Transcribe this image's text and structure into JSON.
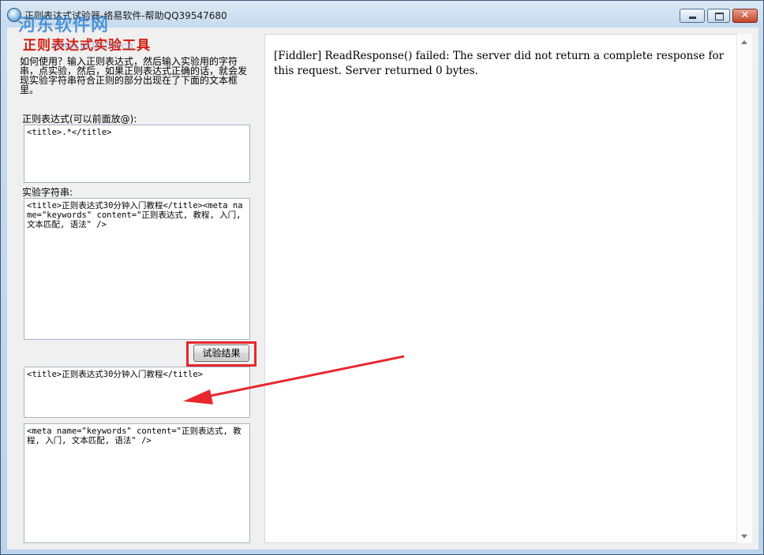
{
  "window": {
    "title": "正则表达式试验器-络易软件-帮助QQ39547680",
    "watermark": "河东软件网",
    "watermark_url": "www.pc0359.cn"
  },
  "app": {
    "heading": "正则表达式实验工具",
    "howto": "如何使用？输入正则表达式，然后输入实验用的字符串，点实验，然后，如果正则表达式正确的话，就会发现实验字符串符合正则的部分出现在了下面的文本框里。",
    "regex_label": "正则表达式(可以前面放@):",
    "regex_value": "<title>.*</title>",
    "test_string_label": "实验字符串:",
    "test_string_value": "<title>正则表达式30分钟入门教程</title><meta name=\"keywords\" content=\"正则表达式, 教程, 入门, 文本匹配, 语法\" />",
    "test_button": "试验结果",
    "result_1": "<title>正则表达式30分钟入门教程</title>",
    "result_2": "<meta name=\"keywords\" content=\"正则表达式, 教程, 入门, 文本匹配, 语法\" />"
  },
  "browser": {
    "message": "[Fiddler] ReadResponse() failed: The server did not return a complete response for this request. Server returned 0 bytes."
  },
  "colors": {
    "annotation": "#e8262d",
    "heading": "#d41a0e"
  }
}
